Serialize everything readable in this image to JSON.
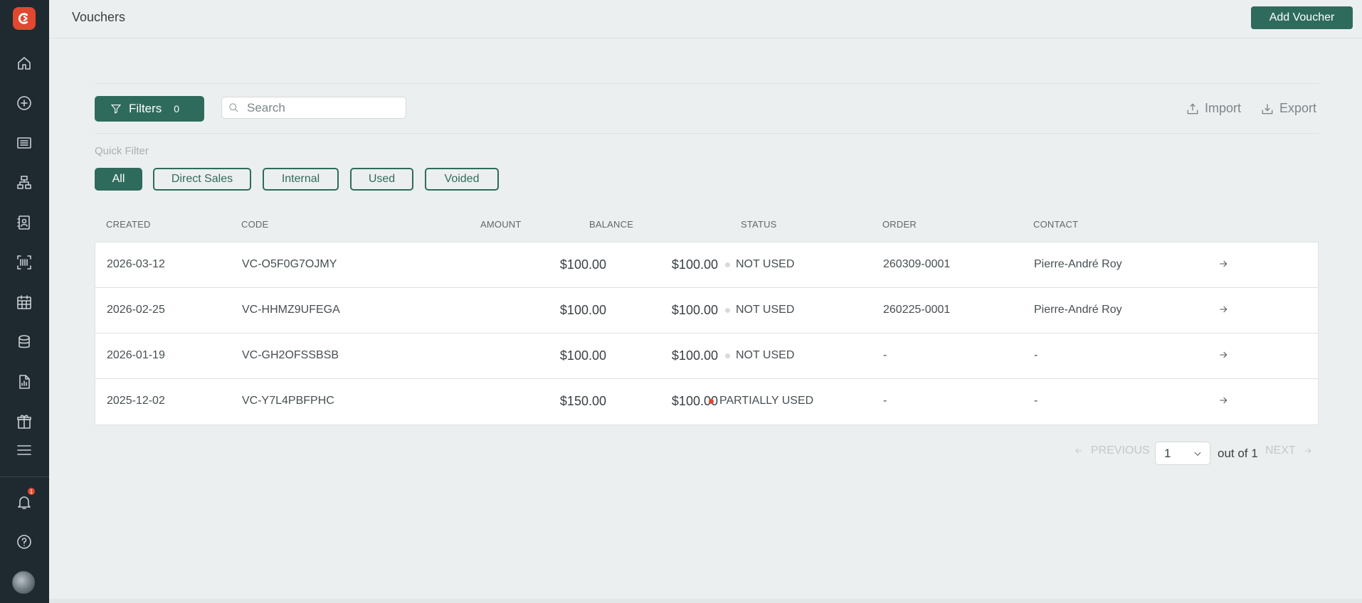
{
  "page": {
    "title": "Vouchers",
    "add_button": "Add Voucher"
  },
  "sidebar": {
    "items": [
      {
        "icon": "home-icon"
      },
      {
        "icon": "plus-circle-icon"
      },
      {
        "icon": "list-icon"
      },
      {
        "icon": "sitemap-icon"
      },
      {
        "icon": "contact-book-icon"
      },
      {
        "icon": "barcode-scan-icon"
      },
      {
        "icon": "calendar-icon"
      },
      {
        "icon": "database-icon"
      },
      {
        "icon": "report-icon"
      },
      {
        "icon": "gift-icon"
      },
      {
        "icon": "menu-icon"
      }
    ],
    "notification_count": "1"
  },
  "toolbar": {
    "filters_label": "Filters",
    "filters_count": "0",
    "search_placeholder": "Search",
    "import_label": "Import",
    "export_label": "Export"
  },
  "quick_filter": {
    "label": "Quick Filter",
    "chips": [
      "All",
      "Direct Sales",
      "Internal",
      "Used",
      "Voided"
    ],
    "active": "All"
  },
  "table": {
    "headers": [
      "CREATED",
      "CODE",
      "AMOUNT",
      "BALANCE",
      "STATUS",
      "ORDER",
      "CONTACT"
    ],
    "rows": [
      {
        "created": "2026-03-12",
        "code": "VC-O5F0G7OJMY",
        "amount": "$100.00",
        "balance": "$100.00",
        "status": "NOT USED",
        "status_color": "#d6dadc",
        "order": "260309-0001",
        "contact": "Pierre-André Roy"
      },
      {
        "created": "2026-02-25",
        "code": "VC-HHMZ9UFEGA",
        "amount": "$100.00",
        "balance": "$100.00",
        "status": "NOT USED",
        "status_color": "#d6dadc",
        "order": "260225-0001",
        "contact": "Pierre-André Roy"
      },
      {
        "created": "2026-01-19",
        "code": "VC-GH2OFSSBSB",
        "amount": "$100.00",
        "balance": "$100.00",
        "status": "NOT USED",
        "status_color": "#d6dadc",
        "order": "-",
        "contact": "-"
      },
      {
        "created": "2025-12-02",
        "code": "VC-Y7L4PBFPHC",
        "amount": "$150.00",
        "balance": "$100.00",
        "status": "PARTIALLY USED",
        "status_color": "#e2472f",
        "order": "-",
        "contact": "-"
      }
    ]
  },
  "pagination": {
    "previous_label": "PREVIOUS",
    "current_page": "1",
    "out_of": "out of 1",
    "next_label": "NEXT"
  },
  "colors": {
    "accent": "#2e6b5c",
    "sidebar": "#1f2a30",
    "brand": "#e2472f"
  }
}
